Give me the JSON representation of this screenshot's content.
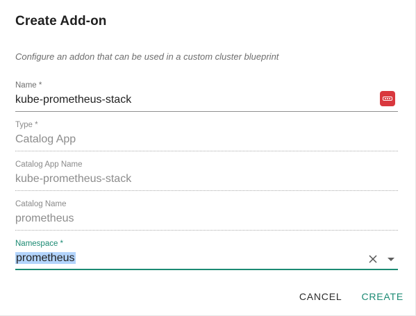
{
  "dialog": {
    "title": "Create Add-on",
    "subtitle": "Configure an addon that can be used in a custom cluster blueprint"
  },
  "fields": {
    "name": {
      "label": "Name *",
      "value": "kube-prometheus-stack",
      "icon": "password-manager-icon"
    },
    "type": {
      "label": "Type *",
      "value": "Catalog App"
    },
    "catalog_app_name": {
      "label": "Catalog App Name",
      "value": "kube-prometheus-stack"
    },
    "catalog_name": {
      "label": "Catalog Name",
      "value": "prometheus"
    },
    "namespace": {
      "label": "Namespace *",
      "value": "prometheus"
    }
  },
  "actions": {
    "cancel_label": "CANCEL",
    "create_label": "CREATE"
  },
  "colors": {
    "accent": "#1b8a73",
    "password_icon": "#d9383e",
    "selection": "#b3d4fc"
  }
}
